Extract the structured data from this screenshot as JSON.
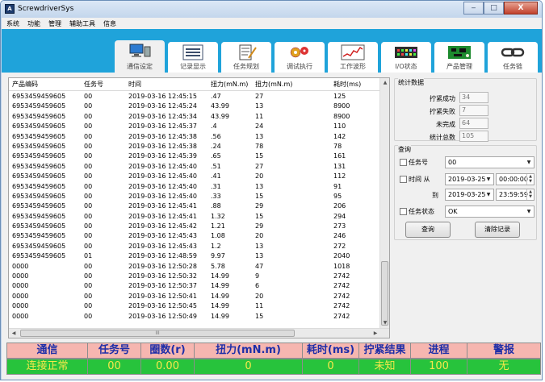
{
  "window": {
    "title": "ScrewdriverSys",
    "app_icon": "A",
    "controls": {
      "minimize": "‒",
      "maximize": "□",
      "close": "X"
    }
  },
  "menu": [
    "系统",
    "功能",
    "管理",
    "辅助工具",
    "信息"
  ],
  "tabs": [
    {
      "label": "通信设定",
      "icon": "computer-icon",
      "selected": true
    },
    {
      "label": "记录显示",
      "icon": "list-icon"
    },
    {
      "label": "任务规划",
      "icon": "document-icon"
    },
    {
      "label": "调试执行",
      "icon": "gear-icon"
    },
    {
      "label": "工作波形",
      "icon": "waveform-icon"
    },
    {
      "label": "I/O状态",
      "icon": "io-board-icon"
    },
    {
      "label": "产品管理",
      "icon": "circuit-board-icon"
    },
    {
      "label": "任务链",
      "icon": "chain-icon"
    }
  ],
  "grid": {
    "columns": [
      "产品编码",
      "任务号",
      "时间",
      "扭力(mN.m)",
      "扭力(mN.m)",
      "耗时(ms)"
    ],
    "rows": [
      [
        "6953459459605",
        "00",
        "2019-03-16 12:45:15",
        ".47",
        "27",
        "125"
      ],
      [
        "6953459459605",
        "00",
        "2019-03-16 12:45:24",
        "43.99",
        "13",
        "8900"
      ],
      [
        "6953459459605",
        "00",
        "2019-03-16 12:45:34",
        "43.99",
        "11",
        "8900"
      ],
      [
        "6953459459605",
        "00",
        "2019-03-16 12:45:37",
        ".4",
        "24",
        "110"
      ],
      [
        "6953459459605",
        "00",
        "2019-03-16 12:45:38",
        ".56",
        "13",
        "142"
      ],
      [
        "6953459459605",
        "00",
        "2019-03-16 12:45:38",
        ".24",
        "78",
        "78"
      ],
      [
        "6953459459605",
        "00",
        "2019-03-16 12:45:39",
        ".65",
        "15",
        "161"
      ],
      [
        "6953459459605",
        "00",
        "2019-03-16 12:45:40",
        ".51",
        "27",
        "131"
      ],
      [
        "6953459459605",
        "00",
        "2019-03-16 12:45:40",
        ".41",
        "20",
        "112"
      ],
      [
        "6953459459605",
        "00",
        "2019-03-16 12:45:40",
        ".31",
        "13",
        "91"
      ],
      [
        "6953459459605",
        "00",
        "2019-03-16 12:45:40",
        ".33",
        "15",
        "95"
      ],
      [
        "6953459459605",
        "00",
        "2019-03-16 12:45:41",
        ".88",
        "29",
        "206"
      ],
      [
        "6953459459605",
        "00",
        "2019-03-16 12:45:41",
        "1.32",
        "15",
        "294"
      ],
      [
        "6953459459605",
        "00",
        "2019-03-16 12:45:42",
        "1.21",
        "29",
        "273"
      ],
      [
        "6953459459605",
        "00",
        "2019-03-16 12:45:43",
        "1.08",
        "20",
        "246"
      ],
      [
        "6953459459605",
        "00",
        "2019-03-16 12:45:43",
        "1.2",
        "13",
        "272"
      ],
      [
        "6953459459605",
        "01",
        "2019-03-16 12:48:59",
        "9.97",
        "13",
        "2040"
      ],
      [
        "0000",
        "00",
        "2019-03-16 12:50:28",
        "5.78",
        "47",
        "1018"
      ],
      [
        "0000",
        "00",
        "2019-03-16 12:50:32",
        "14.99",
        "9",
        "2742"
      ],
      [
        "0000",
        "00",
        "2019-03-16 12:50:37",
        "14.99",
        "6",
        "2742"
      ],
      [
        "0000",
        "00",
        "2019-03-16 12:50:41",
        "14.99",
        "20",
        "2742"
      ],
      [
        "0000",
        "00",
        "2019-03-16 12:50:45",
        "14.99",
        "11",
        "2742"
      ],
      [
        "0000",
        "00",
        "2019-03-16 12:50:49",
        "14.99",
        "15",
        "2742"
      ]
    ],
    "scroll_thumb_grip": "III"
  },
  "stats": {
    "title": "统计数据",
    "items": [
      {
        "label": "拧紧成功",
        "value": "34"
      },
      {
        "label": "拧紧失败",
        "value": "7"
      },
      {
        "label": "未完成",
        "value": "64"
      },
      {
        "label": "统计总数",
        "value": "105"
      }
    ]
  },
  "query": {
    "title": "查询",
    "task_label": "任务号",
    "task_value": "00",
    "time_from_label": "时间 从",
    "from_date": "2019-03-25",
    "from_time": "00:00:00",
    "to_label": "到",
    "to_date": "2019-03-25",
    "to_time": "23:59:59",
    "status_label": "任务状态",
    "status_value": "OK",
    "query_button": "查询",
    "clear_button": "清除记录"
  },
  "status": {
    "headers": [
      "通信",
      "任务号",
      "圈数(r)",
      "扭力(mN.m)",
      "耗时(ms)",
      "拧紧结果",
      "进程",
      "警报"
    ],
    "values": [
      "连接正常",
      "00",
      "0.00",
      "0",
      "0",
      "未知",
      "100",
      "无"
    ]
  },
  "colors": {
    "ribbon": "#1fa3da",
    "status_header": "#f6b6b0",
    "status_values": "#27c33c",
    "status_value_text": "#f5e84a",
    "status_header_text": "#1e2ea8"
  }
}
